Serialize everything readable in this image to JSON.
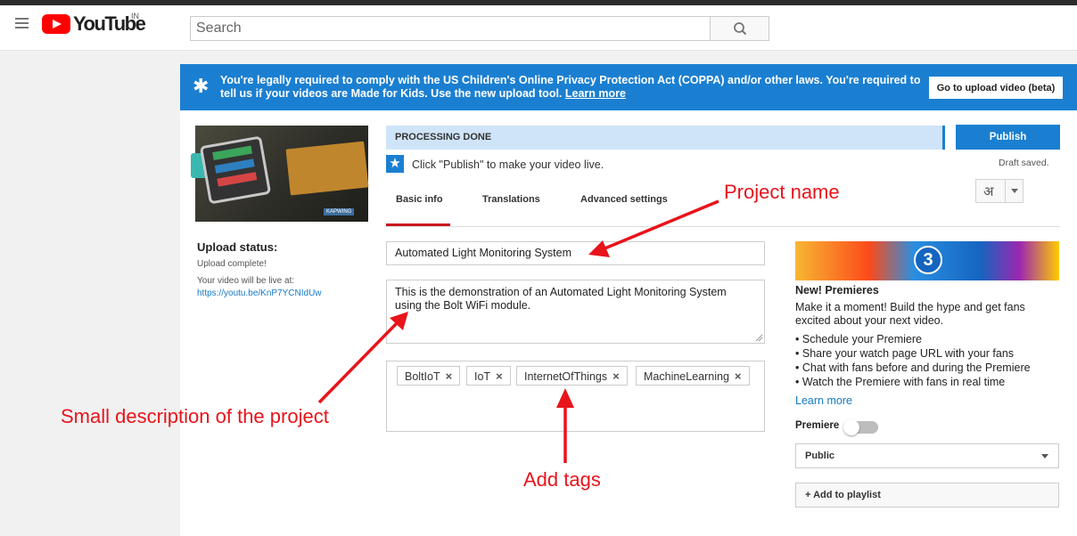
{
  "header": {
    "logo_text": "YouTube",
    "country_code": "IN",
    "search_placeholder": "Search"
  },
  "banner": {
    "text": "You're legally required to comply with the US Children's Online Privacy Protection Act (COPPA) and/or other laws. You're required to tell us if your videos are Made for Kids. Use the new upload tool.",
    "link_text": "Learn more",
    "button_label": "Go to upload video (beta)"
  },
  "video": {
    "thumbnail_watermark": "KAPWING",
    "upload_status_label": "Upload status:",
    "upload_status_value": "Upload complete!",
    "live_label": "Your video will be live at:",
    "live_url": "https://youtu.be/KnP7YCNIdUw"
  },
  "processing": {
    "status": "PROCESSING DONE",
    "publish_label": "Publish",
    "draft_status": "Draft saved.",
    "hint": "Click \"Publish\" to make your video live."
  },
  "tabs": [
    {
      "label": "Basic info",
      "active": true
    },
    {
      "label": "Translations",
      "active": false
    },
    {
      "label": "Advanced settings",
      "active": false
    }
  ],
  "language_button_glyph": "अ",
  "form": {
    "title": "Automated Light Monitoring System",
    "description": "This is the demonstration of an Automated Light Monitoring System using the Bolt WiFi module.",
    "tags": [
      "BoltIoT",
      "IoT",
      "InternetOfThings",
      "MachineLearning"
    ]
  },
  "promo": {
    "countdown_number": "3",
    "title": "New! Premieres",
    "description": "Make it a moment! Build the hype and get fans excited about your next video.",
    "bullets": [
      "Schedule your Premiere",
      "Share your watch page URL with your fans",
      "Chat with fans before and during the Premiere",
      "Watch the Premiere with fans in real time"
    ],
    "learn_more": "Learn more",
    "premiere_label": "Premiere",
    "premiere_enabled": false
  },
  "visibility": {
    "selected": "Public"
  },
  "playlist_button": "+ Add to playlist",
  "annotations": {
    "project_name": "Project name",
    "description": "Small description of the project",
    "tags": "Add tags",
    "color": "#e8141b"
  },
  "colors": {
    "brand_red": "#ff0000",
    "accent_blue": "#1b7fd1",
    "link_blue": "#167ac6"
  }
}
